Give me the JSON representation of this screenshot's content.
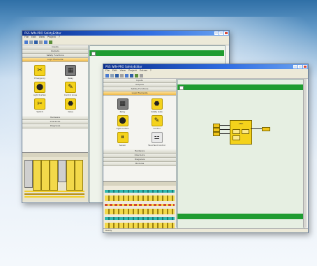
{
  "back_window": {
    "title": "PSS WIN-PRO SafetyEditor",
    "menu": [
      "File",
      "Edit",
      "View",
      "Project",
      "?"
    ],
    "panel_sections": [
      "Inputs",
      "Outputs",
      "Safety Functions",
      "Logic Elements",
      "Function Elements"
    ],
    "icons": [
      {
        "name": "emergency-stop-icon",
        "label": "Emergency",
        "style": "yellow",
        "glyph": "✂"
      },
      {
        "name": "relay-icon",
        "label": "Relay",
        "style": "gray",
        "glyph": "▦"
      },
      {
        "name": "light-curtain-icon",
        "label": "Light Curtain",
        "style": "yellow",
        "glyph": "⬤"
      },
      {
        "name": "pen-icon",
        "label": "Control Lines",
        "style": "yellow",
        "glyph": "✎"
      },
      {
        "name": "switch-icon",
        "label": "Switch",
        "style": "yellow",
        "glyph": "✂"
      },
      {
        "name": "valve-icon",
        "label": "Valve",
        "style": "yellow",
        "glyph": "⬣"
      }
    ],
    "lower_sections": [
      "Hardware",
      "Interlocks",
      "Diagnosis"
    ]
  },
  "front_window": {
    "title": "PSS WIN-PRO SafetyEditor",
    "menu": [
      "File",
      "Edit",
      "View",
      "Project",
      "Extras",
      "?"
    ],
    "panel_sections": [
      "Inputs",
      "Outputs",
      "Safety Functions",
      "Logic Elements"
    ],
    "icons": [
      {
        "name": "relay-icon",
        "label": "Relay",
        "style": "gray",
        "glyph": "▦"
      },
      {
        "name": "safety-gate-icon",
        "label": "Safety Gate",
        "style": "yellow",
        "glyph": "⬣"
      },
      {
        "name": "light-curtain-icon",
        "label": "Light Curtain",
        "style": "yellow",
        "glyph": "⬤"
      },
      {
        "name": "pen-icon",
        "label": "Control",
        "style": "yellow",
        "glyph": "✎"
      },
      {
        "name": "sensor-icon",
        "label": "Sensor",
        "style": "yellow",
        "glyph": "⏸"
      },
      {
        "name": "two-hand-icon",
        "label": "Two-Hand Control",
        "style": "plain",
        "glyph": "⚍"
      }
    ],
    "lower_sections": [
      "Hardware",
      "Interlocks",
      "Diagnosis",
      "Modules"
    ],
    "canvas_block_label": "AND",
    "statusbar": "Ready"
  },
  "colors": {
    "accent_green": "#1f9c31",
    "module_yellow": "#f4d21b",
    "title_blue": "#0a2e8c"
  }
}
